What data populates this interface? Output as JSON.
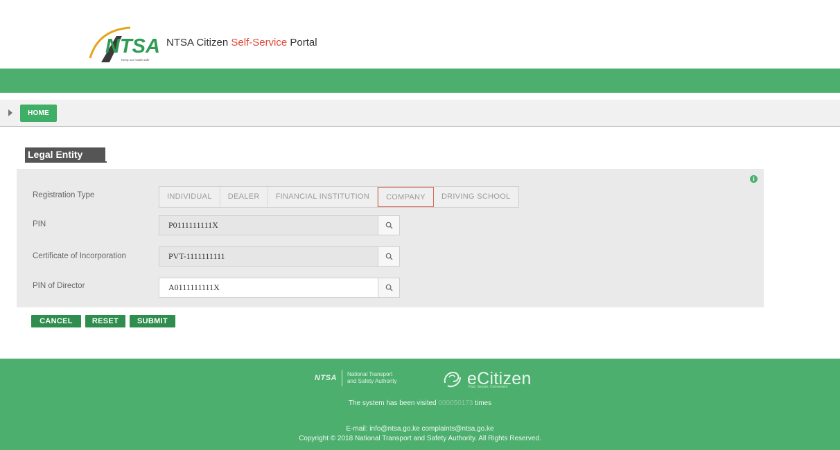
{
  "header": {
    "logo_text": "NTSA",
    "logo_tagline": "Keep our roads safe",
    "portal_prefix": "NTSA Citizen ",
    "portal_accent": "Self-Service",
    "portal_suffix": " Portal"
  },
  "breadcrumb": {
    "home": "HOME"
  },
  "section": {
    "title": "Legal Entity"
  },
  "form": {
    "registration_type_label": "Registration Type",
    "registration_options": [
      "INDIVIDUAL",
      "DEALER",
      "FINANCIAL INSTITUTION",
      "COMPANY",
      "DRIVING SCHOOL"
    ],
    "selected_option": "COMPANY",
    "pin_label": "PIN",
    "pin_value": "P0111111111X",
    "cert_label": "Certificate of Incorporation",
    "cert_value": "PVT-1111111111",
    "director_label": "PIN of Director",
    "director_value": "A0111111111X"
  },
  "actions": {
    "cancel": "CANCEL",
    "reset": "RESET",
    "submit": "SUBMIT"
  },
  "footer": {
    "ntsa_badge": "NTSA",
    "ntsa_line1": "National Transport",
    "ntsa_line2": "and Safety Authority",
    "ecitizen": "eCitizen",
    "ecitizen_sub": "Fast, Secure, Convenient",
    "visited_prefix": "The system has been visited ",
    "visited_count": "000050173",
    "visited_suffix": " times",
    "email_line": "E-mail: info@ntsa.go.ke    complaints@ntsa.go.ke",
    "copyright": "Copyright © 2018 National Transport and Safety Authority. All Rights Reserved."
  },
  "colors": {
    "brand_green": "#4caf6e",
    "button_green": "#2f8d4e",
    "accent_red": "#e04a3a"
  }
}
